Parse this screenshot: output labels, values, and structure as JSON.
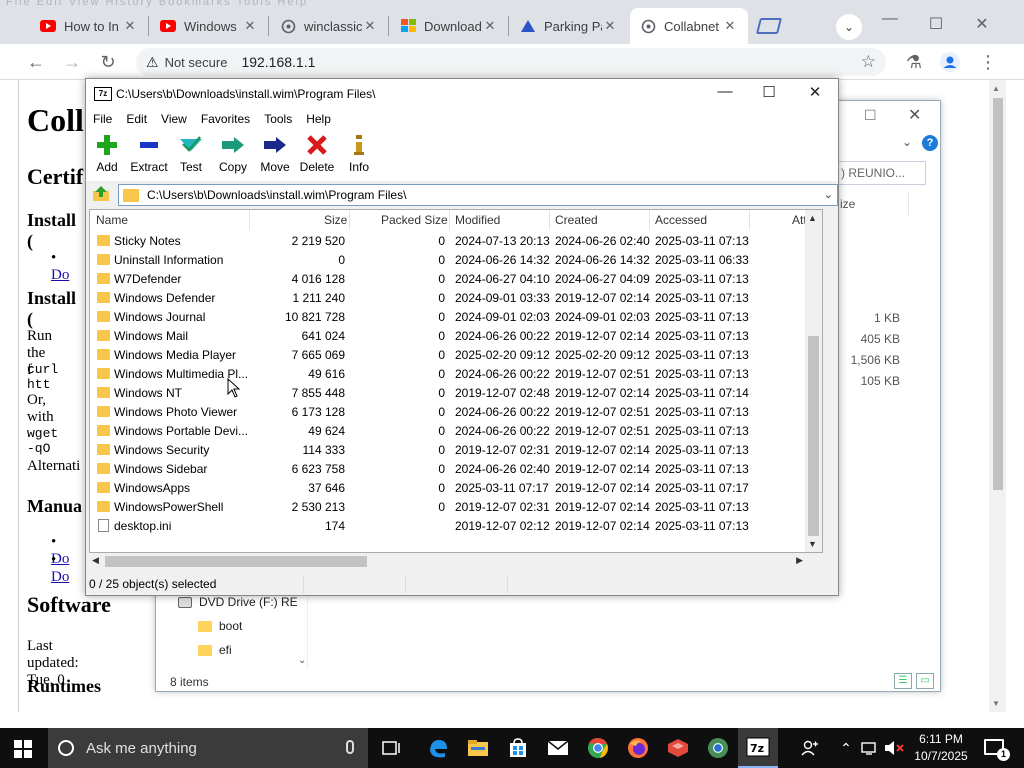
{
  "browser": {
    "menu_ghost": "File  Edit  View  History  Bookmarks  Tools  Help",
    "tabs": [
      {
        "label": "How to In",
        "icon": "youtube-icon"
      },
      {
        "label": "Windows",
        "icon": "youtube-icon"
      },
      {
        "label": "winclassic",
        "icon": "globe-icon"
      },
      {
        "label": "Download",
        "icon": "windows-flag-icon"
      },
      {
        "label": "Parking Pa",
        "icon": "triangle-icon"
      },
      {
        "label": "Collabnet",
        "icon": "globe-icon",
        "active": true
      }
    ],
    "address": {
      "security": "Not secure",
      "url": "192.168.1.1"
    }
  },
  "page": {
    "title": "Coll",
    "h_cert": "Certif",
    "h_install1": "Install (",
    "link_do1": "Do",
    "h_install2": "Install (",
    "run_the": "Run the f",
    "curl": "curl htt",
    "or_with": "Or, with",
    "wget": "wget -qO",
    "alternat": "Alternati",
    "h_manual": "Manua",
    "link_do2": "Do",
    "link_do3": "Do",
    "h_software": "Software",
    "last_updated": "Last updated: Tue, 0",
    "h_runtimes": "Runtimes"
  },
  "explorer": {
    "search_placeholder": ") REUNIO...",
    "col_size": "ize",
    "sizes": [
      "1 KB",
      "405 KB",
      "1,506 KB",
      "105 KB"
    ],
    "nav": [
      {
        "label": "DVD Drive (F:) RE"
      },
      {
        "label": "boot"
      },
      {
        "label": "efi"
      }
    ],
    "status": "8 items"
  },
  "sevenzip": {
    "title": "C:\\Users\\b\\Downloads\\install.wim\\Program Files\\",
    "logo": "7z",
    "menu": [
      "File",
      "Edit",
      "View",
      "Favorites",
      "Tools",
      "Help"
    ],
    "tools": [
      {
        "label": "Add",
        "icon": "add-icon"
      },
      {
        "label": "Extract",
        "icon": "extract-icon"
      },
      {
        "label": "Test",
        "icon": "test-icon"
      },
      {
        "label": "Copy",
        "icon": "copy-icon"
      },
      {
        "label": "Move",
        "icon": "move-icon"
      },
      {
        "label": "Delete",
        "icon": "delete-icon"
      },
      {
        "label": "Info",
        "icon": "info-icon"
      }
    ],
    "path": "C:\\Users\\b\\Downloads\\install.wim\\Program Files\\",
    "columns": [
      "Name",
      "Size",
      "Packed Size",
      "Modified",
      "Created",
      "Accessed",
      "Attrib"
    ],
    "rows": [
      {
        "name": "Sticky Notes",
        "size": "2 219 520",
        "packed": "0",
        "modified": "2024-07-13 20:13",
        "created": "2024-06-26 02:40",
        "accessed": "2025-03-11 07:13",
        "type": "folder"
      },
      {
        "name": "Uninstall Information",
        "size": "0",
        "packed": "0",
        "modified": "2024-06-26 14:32",
        "created": "2024-06-26 14:32",
        "accessed": "2025-03-11 06:33",
        "type": "folder"
      },
      {
        "name": "W7Defender",
        "size": "4 016 128",
        "packed": "0",
        "modified": "2024-06-27 04:10",
        "created": "2024-06-27 04:09",
        "accessed": "2025-03-11 07:13",
        "type": "folder"
      },
      {
        "name": "Windows Defender",
        "size": "1 211 240",
        "packed": "0",
        "modified": "2024-09-01 03:33",
        "created": "2019-12-07 02:14",
        "accessed": "2025-03-11 07:13",
        "type": "folder"
      },
      {
        "name": "Windows Journal",
        "size": "10 821 728",
        "packed": "0",
        "modified": "2024-09-01 02:03",
        "created": "2024-09-01 02:03",
        "accessed": "2025-03-11 07:13",
        "type": "folder"
      },
      {
        "name": "Windows Mail",
        "size": "641 024",
        "packed": "0",
        "modified": "2024-06-26 00:22",
        "created": "2019-12-07 02:14",
        "accessed": "2025-03-11 07:13",
        "type": "folder"
      },
      {
        "name": "Windows Media Player",
        "size": "7 665 069",
        "packed": "0",
        "modified": "2025-02-20 09:12",
        "created": "2025-02-20 09:12",
        "accessed": "2025-03-11 07:13",
        "type": "folder"
      },
      {
        "name": "Windows Multimedia Pl...",
        "size": "49 616",
        "packed": "0",
        "modified": "2024-06-26 00:22",
        "created": "2019-12-07 02:51",
        "accessed": "2025-03-11 07:13",
        "type": "folder"
      },
      {
        "name": "Windows NT",
        "size": "7 855 448",
        "packed": "0",
        "modified": "2019-12-07 02:48",
        "created": "2019-12-07 02:14",
        "accessed": "2025-03-11 07:14",
        "type": "folder"
      },
      {
        "name": "Windows Photo Viewer",
        "size": "6 173 128",
        "packed": "0",
        "modified": "2024-06-26 00:22",
        "created": "2019-12-07 02:51",
        "accessed": "2025-03-11 07:13",
        "type": "folder"
      },
      {
        "name": "Windows Portable Devi...",
        "size": "49 624",
        "packed": "0",
        "modified": "2024-06-26 00:22",
        "created": "2019-12-07 02:51",
        "accessed": "2025-03-11 07:13",
        "type": "folder"
      },
      {
        "name": "Windows Security",
        "size": "114 333",
        "packed": "0",
        "modified": "2019-12-07 02:31",
        "created": "2019-12-07 02:14",
        "accessed": "2025-03-11 07:13",
        "type": "folder"
      },
      {
        "name": "Windows Sidebar",
        "size": "6 623 758",
        "packed": "0",
        "modified": "2024-06-26 02:40",
        "created": "2019-12-07 02:14",
        "accessed": "2025-03-11 07:13",
        "type": "folder"
      },
      {
        "name": "WindowsApps",
        "size": "37 646",
        "packed": "0",
        "modified": "2025-03-11 07:17",
        "created": "2019-12-07 02:14",
        "accessed": "2025-03-11 07:17",
        "type": "folder"
      },
      {
        "name": "WindowsPowerShell",
        "size": "2 530 213",
        "packed": "0",
        "modified": "2019-12-07 02:31",
        "created": "2019-12-07 02:14",
        "accessed": "2025-03-11 07:13",
        "type": "folder"
      },
      {
        "name": "desktop.ini",
        "size": "174",
        "packed": "",
        "modified": "2019-12-07 02:12",
        "created": "2019-12-07 02:14",
        "accessed": "2025-03-11 07:13",
        "type": "file"
      }
    ],
    "status": "0 / 25 object(s) selected"
  },
  "taskbar": {
    "search_placeholder": "Ask me anything",
    "time": "6:11 PM",
    "date": "10/7/2025",
    "notification_count": "1",
    "apps": [
      "task-view-icon",
      "edge-icon",
      "file-explorer-icon",
      "store-icon",
      "mail-icon",
      "chrome-icon",
      "firefox-icon",
      "app-icon",
      "chrome-alt-icon",
      "7zip-icon"
    ]
  }
}
